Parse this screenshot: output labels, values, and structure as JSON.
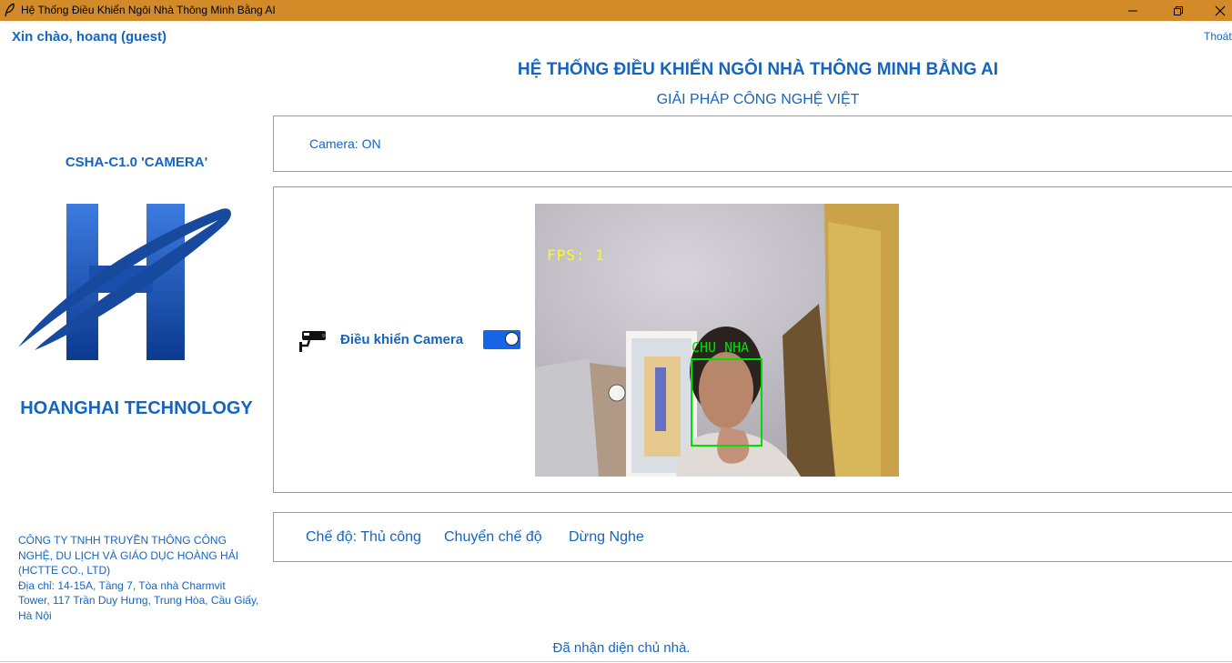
{
  "window": {
    "title": "Hệ Thống Điều Khiển Ngôi Nhà Thông Minh Bằng AI",
    "icon": "feather-icon"
  },
  "header": {
    "greeting": "Xin chào, hoanq (guest)",
    "logout_label": "Thoát",
    "title": "HỆ THỐNG ĐIỀU KHIỂN NGÔI NHÀ THÔNG MINH BẰNG AI",
    "subtitle": "GIẢI PHÁP CÔNG NGHỆ VIỆT"
  },
  "sidebar": {
    "model": "CSHA-C1.0 'CAMERA'",
    "brand": "HOANGHAI TECHNOLOGY",
    "company_name": "CÔNG TY TNHH TRUYỀN THÔNG CÔNG NGHỆ, DU LỊCH VÀ GIÁO DỤC HOÀNG HẢI (HCTTE CO., LTD)",
    "company_address": "Địa chỉ: 14-15A, Tầng 7, Tòa nhà Charmvit Tower, 117 Trần Duy Hưng, Trung Hòa, Cầu Giấy, Hà Nội"
  },
  "camera_panel": {
    "status": "Camera: ON"
  },
  "control_panel": {
    "label": "Điều khiển Camera",
    "toggle_on": true,
    "feed": {
      "fps_text": "FPS:  1",
      "face_label": "CHU  NHA"
    }
  },
  "mode_panel": {
    "mode": "Chế độ: Thủ công",
    "switch_label": "Chuyển chế độ",
    "stop_label": "Dừng Nghe"
  },
  "status": {
    "message": "Đã nhận diện chủ nhà."
  },
  "colors": {
    "titlebar": "#d38b2a",
    "accent": "#1565c0",
    "toggle": "#1565e6",
    "detection": "#00e000",
    "fps": "#ffff00"
  }
}
